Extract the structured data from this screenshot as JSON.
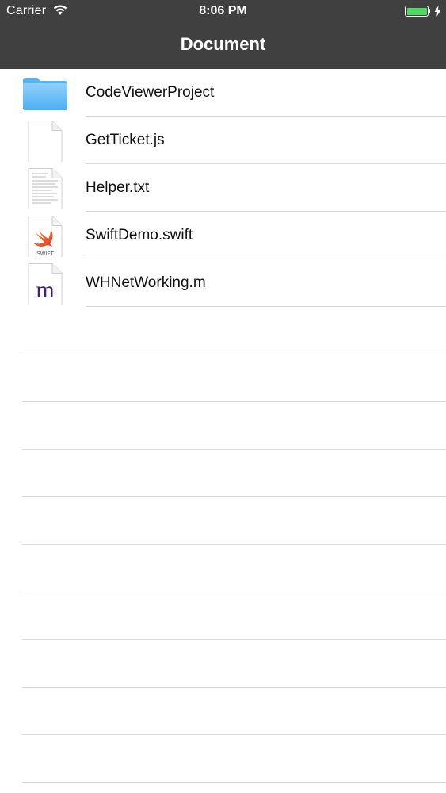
{
  "status_bar": {
    "carrier": "Carrier",
    "time": "8:06 PM",
    "battery_color": "#4cd964"
  },
  "nav": {
    "title": "Document",
    "background_color": "#404040"
  },
  "files": [
    {
      "name": "CodeViewerProject",
      "icon": "folder-icon"
    },
    {
      "name": "GetTicket.js",
      "icon": "blank-file-icon"
    },
    {
      "name": "Helper.txt",
      "icon": "text-file-icon"
    },
    {
      "name": "SwiftDemo.swift",
      "icon": "swift-file-icon",
      "icon_text": "SWIFT"
    },
    {
      "name": "WHNetWorking.m",
      "icon": "objc-file-icon",
      "icon_text": "m"
    }
  ]
}
